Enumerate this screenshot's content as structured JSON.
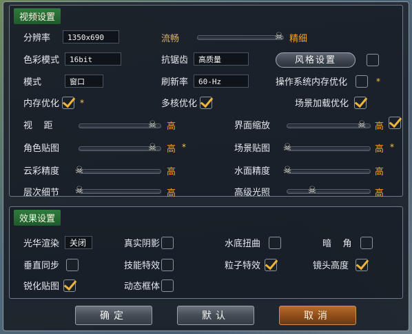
{
  "video": {
    "title": "视频设置",
    "resolution_label": "分辨率",
    "resolution_value": "1350x690",
    "fluency_label": "流畅",
    "fine_label": "精细",
    "quality_level": 0.95,
    "color_mode_label": "色彩模式",
    "color_mode_value": "16bit",
    "aa_label": "抗锯齿",
    "aa_value": "高质量",
    "style_button": "风格设置",
    "style_checked": false,
    "mode_label": "模式",
    "mode_value": "窗口",
    "refresh_label": "刷新率",
    "refresh_value": "60-Hz",
    "os_memory_label": "操作系统内存优化",
    "os_memory_checked": false,
    "mem_opt_label": "内存优化",
    "mem_opt_checked": true,
    "multicore_label": "多核优化",
    "multicore_checked": true,
    "scene_load_label": "场景加载优化",
    "scene_load_checked": true,
    "view_distance_label": "视    距",
    "view_distance_value": "高",
    "view_distance_level": 0.9,
    "ui_scale_label": "界面缩放",
    "ui_scale_value": "高",
    "ui_scale_checked": true,
    "ui_scale_level": 0.9,
    "char_texture_label": "角色贴图",
    "char_texture_value": "高",
    "char_texture_level": 0.9,
    "scene_texture_label": "场景贴图",
    "scene_texture_value": "高",
    "scene_texture_level": 0.0,
    "cloud_label": "云彩精度",
    "cloud_value": "高",
    "cloud_level": 0.0,
    "water_label": "水面精度",
    "water_value": "高",
    "water_level": 0.0,
    "lod_label": "层次细节",
    "lod_value": "高",
    "lod_level": 0.0,
    "lighting_label": "高级光照",
    "lighting_value": "高",
    "lighting_level": 0.3,
    "star": "*"
  },
  "effects": {
    "title": "效果设置",
    "bloom_label": "光华渲染",
    "bloom_value": "关闭",
    "shadow_label": "真实阴影",
    "shadow_checked": false,
    "underwater_label": "水底扭曲",
    "underwater_checked": false,
    "vignette_label": "暗    角",
    "vignette_checked": false,
    "vsync_label": "垂直同步",
    "vsync_checked": false,
    "skill_fx_label": "技能特效",
    "skill_fx_checked": false,
    "particle_label": "粒子特效",
    "particle_checked": true,
    "camera_height_label": "镜头高度",
    "camera_height_checked": true,
    "sharpen_label": "锐化贴图",
    "sharpen_checked": true,
    "motion_frame_label": "动态框体",
    "motion_frame_checked": false
  },
  "buttons": {
    "confirm": "确定",
    "default": "默认",
    "cancel": "取消"
  },
  "colors": {
    "accent_orange": "#f3a323",
    "section_green": "#2f7c3e",
    "check_orange": "#f0b43a"
  },
  "icons": {
    "slider_knob": "skull-crossbones-icon"
  }
}
